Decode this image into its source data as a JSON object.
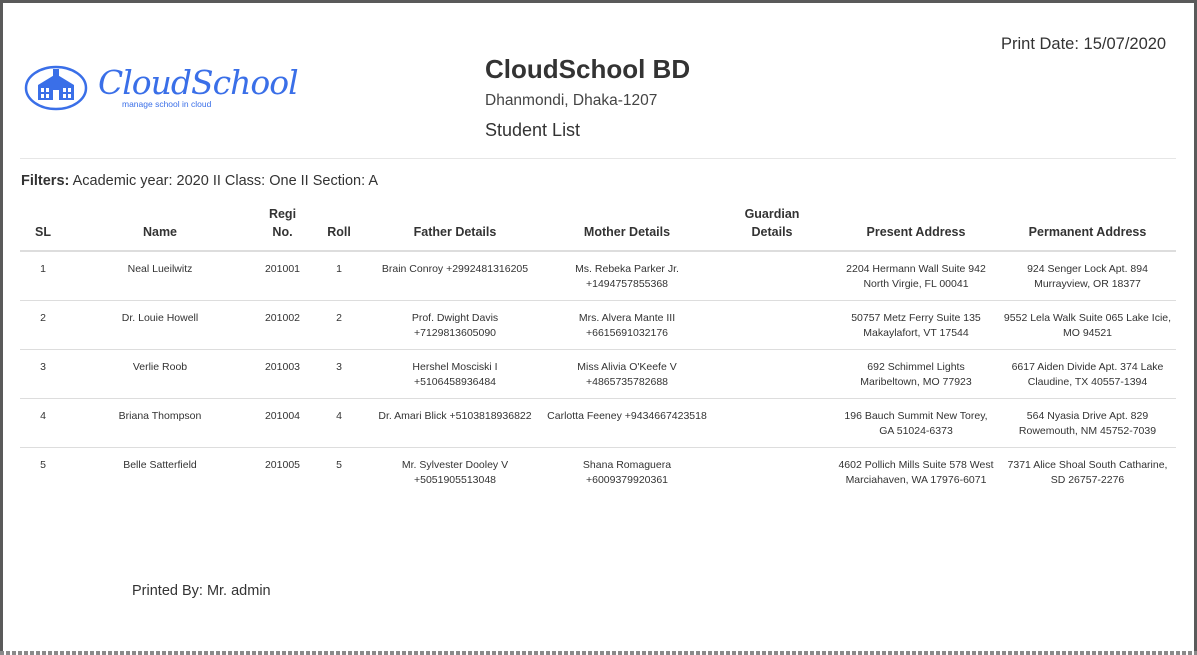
{
  "header": {
    "print_date": "Print Date: 15/07/2020",
    "logo_text": "CloudSchool",
    "logo_tagline": "manage school in cloud",
    "school_name": "CloudSchool BD",
    "school_address": "Dhanmondi, Dhaka-1207",
    "report_title": "Student List"
  },
  "filters": {
    "label": "Filters:",
    "value": "Academic year: 2020 II Class: One II Section: A"
  },
  "table": {
    "columns": {
      "sl": "SL",
      "name": "Name",
      "regi_line1": "Regi",
      "regi_line2": "No.",
      "roll": "Roll",
      "father": "Father Details",
      "mother": "Mother Details",
      "guardian_line1": "Guardian",
      "guardian_line2": "Details",
      "present": "Present Address",
      "permanent": "Permanent Address"
    },
    "rows": [
      {
        "sl": "1",
        "name": "Neal Lueilwitz",
        "regi": "201001",
        "roll": "1",
        "father": "Brain Conroy +2992481316205",
        "mother": "Ms. Rebeka Parker Jr. +1494757855368",
        "guardian": "",
        "present": "2204 Hermann Wall Suite 942 North Virgie, FL 00041",
        "permanent": "924 Senger Lock Apt. 894 Murrayview, OR 18377"
      },
      {
        "sl": "2",
        "name": "Dr. Louie Howell",
        "regi": "201002",
        "roll": "2",
        "father": "Prof. Dwight Davis +7129813605090",
        "mother": "Mrs. Alvera Mante III +6615691032176",
        "guardian": "",
        "present": "50757 Metz Ferry Suite 135 Makaylafort, VT 17544",
        "permanent": "9552 Lela Walk Suite 065 Lake Icie, MO 94521"
      },
      {
        "sl": "3",
        "name": "Verlie Roob",
        "regi": "201003",
        "roll": "3",
        "father": "Hershel Mosciski I +5106458936484",
        "mother": "Miss Alivia O'Keefe V +4865735782688",
        "guardian": "",
        "present": "692 Schimmel Lights Maribeltown, MO 77923",
        "permanent": "6617 Aiden Divide Apt. 374 Lake Claudine, TX 40557-1394"
      },
      {
        "sl": "4",
        "name": "Briana Thompson",
        "regi": "201004",
        "roll": "4",
        "father": "Dr. Amari Blick +5103818936822",
        "mother": "Carlotta Feeney +9434667423518",
        "guardian": "",
        "present": "196 Bauch Summit New Torey, GA 51024-6373",
        "permanent": "564 Nyasia Drive Apt. 829 Rowemouth, NM 45752-7039"
      },
      {
        "sl": "5",
        "name": "Belle Satterfield",
        "regi": "201005",
        "roll": "5",
        "father": "Mr. Sylvester Dooley V +5051905513048",
        "mother": "Shana Romaguera +6009379920361",
        "guardian": "",
        "present": "4602 Pollich Mills Suite 578 West Marciahaven, WA 17976-6071",
        "permanent": "7371 Alice Shoal South Catharine, SD 26757-2276"
      }
    ]
  },
  "footer": {
    "printed_by": "Printed By: Mr. admin"
  },
  "colors": {
    "brand_blue": "#3a6fe8",
    "text": "#333333",
    "rule": "#dddddd"
  }
}
